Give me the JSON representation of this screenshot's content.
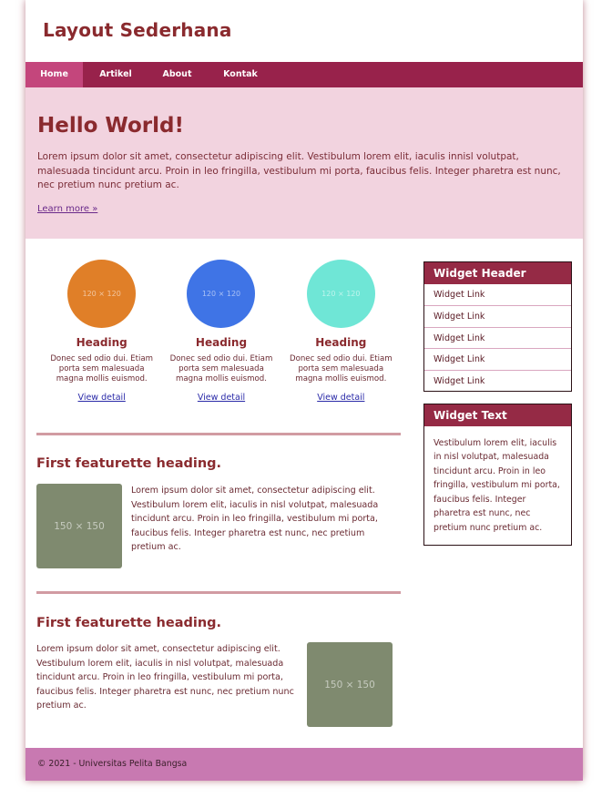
{
  "site": {
    "title": "Layout Sederhana"
  },
  "nav": {
    "items": [
      {
        "label": "Home",
        "active": true
      },
      {
        "label": "Artikel",
        "active": false
      },
      {
        "label": "About",
        "active": false
      },
      {
        "label": "Kontak",
        "active": false
      }
    ]
  },
  "hero": {
    "title": "Hello World!",
    "text": "Lorem ipsum dolor sit amet, consectetur adipiscing elit. Vestibulum lorem elit, iaculis innisl volutpat, malesuada tincidunt arcu. Proin in leo fringilla, vestibulum mi porta, faucibus felis. Integer pharetra est nunc, nec pretium nunc pretium ac.",
    "link": "Learn more »"
  },
  "columns": [
    {
      "image_text": "120 × 120",
      "color": "#e07f28",
      "heading": "Heading",
      "text": "Donec sed odio dui. Etiam porta sem malesuada magna mollis euismod.",
      "link": "View detail"
    },
    {
      "image_text": "120 × 120",
      "color": "#3f74e6",
      "heading": "Heading",
      "text": "Donec sed odio dui. Etiam porta sem malesuada magna mollis euismod.",
      "link": "View detail"
    },
    {
      "image_text": "120 × 120",
      "color": "#6fe6d6",
      "heading": "Heading",
      "text": "Donec sed odio dui. Etiam porta sem malesuada magna mollis euismod.",
      "link": "View detail"
    }
  ],
  "featurettes": [
    {
      "heading": "First featurette heading.",
      "image_text": "150 × 150",
      "text": "Lorem ipsum dolor sit amet, consectetur adipiscing elit. Vestibulum lorem elit, iaculis in nisl volutpat, malesuada tincidunt arcu. Proin in leo fringilla, vestibulum mi porta, faucibus felis. Integer pharetra est nunc, nec pretium pretium ac."
    },
    {
      "heading": "First featurette heading.",
      "image_text": "150 × 150",
      "text": "Lorem ipsum dolor sit amet, consectetur adipiscing elit. Vestibulum lorem elit, iaculis in nisl volutpat, malesuada tincidunt arcu. Proin in leo fringilla, vestibulum mi porta, faucibus felis. Integer pharetra est nunc, nec pretium nunc pretium ac."
    }
  ],
  "sidebar": {
    "widget_links": {
      "header": "Widget Header",
      "links": [
        "Widget Link",
        "Widget Link",
        "Widget Link",
        "Widget Link",
        "Widget Link"
      ]
    },
    "widget_text": {
      "header": "Widget Text",
      "text": "Vestibulum lorem elit, iaculis in nisl volutpat, malesuada tincidunt arcu. Proin in leo fringilla, vestibulum mi porta, faucibus felis. Integer pharetra est nunc, nec pretium nunc pretium ac."
    }
  },
  "footer": {
    "text": "© 2021 - Universitas Pelita Bangsa"
  }
}
